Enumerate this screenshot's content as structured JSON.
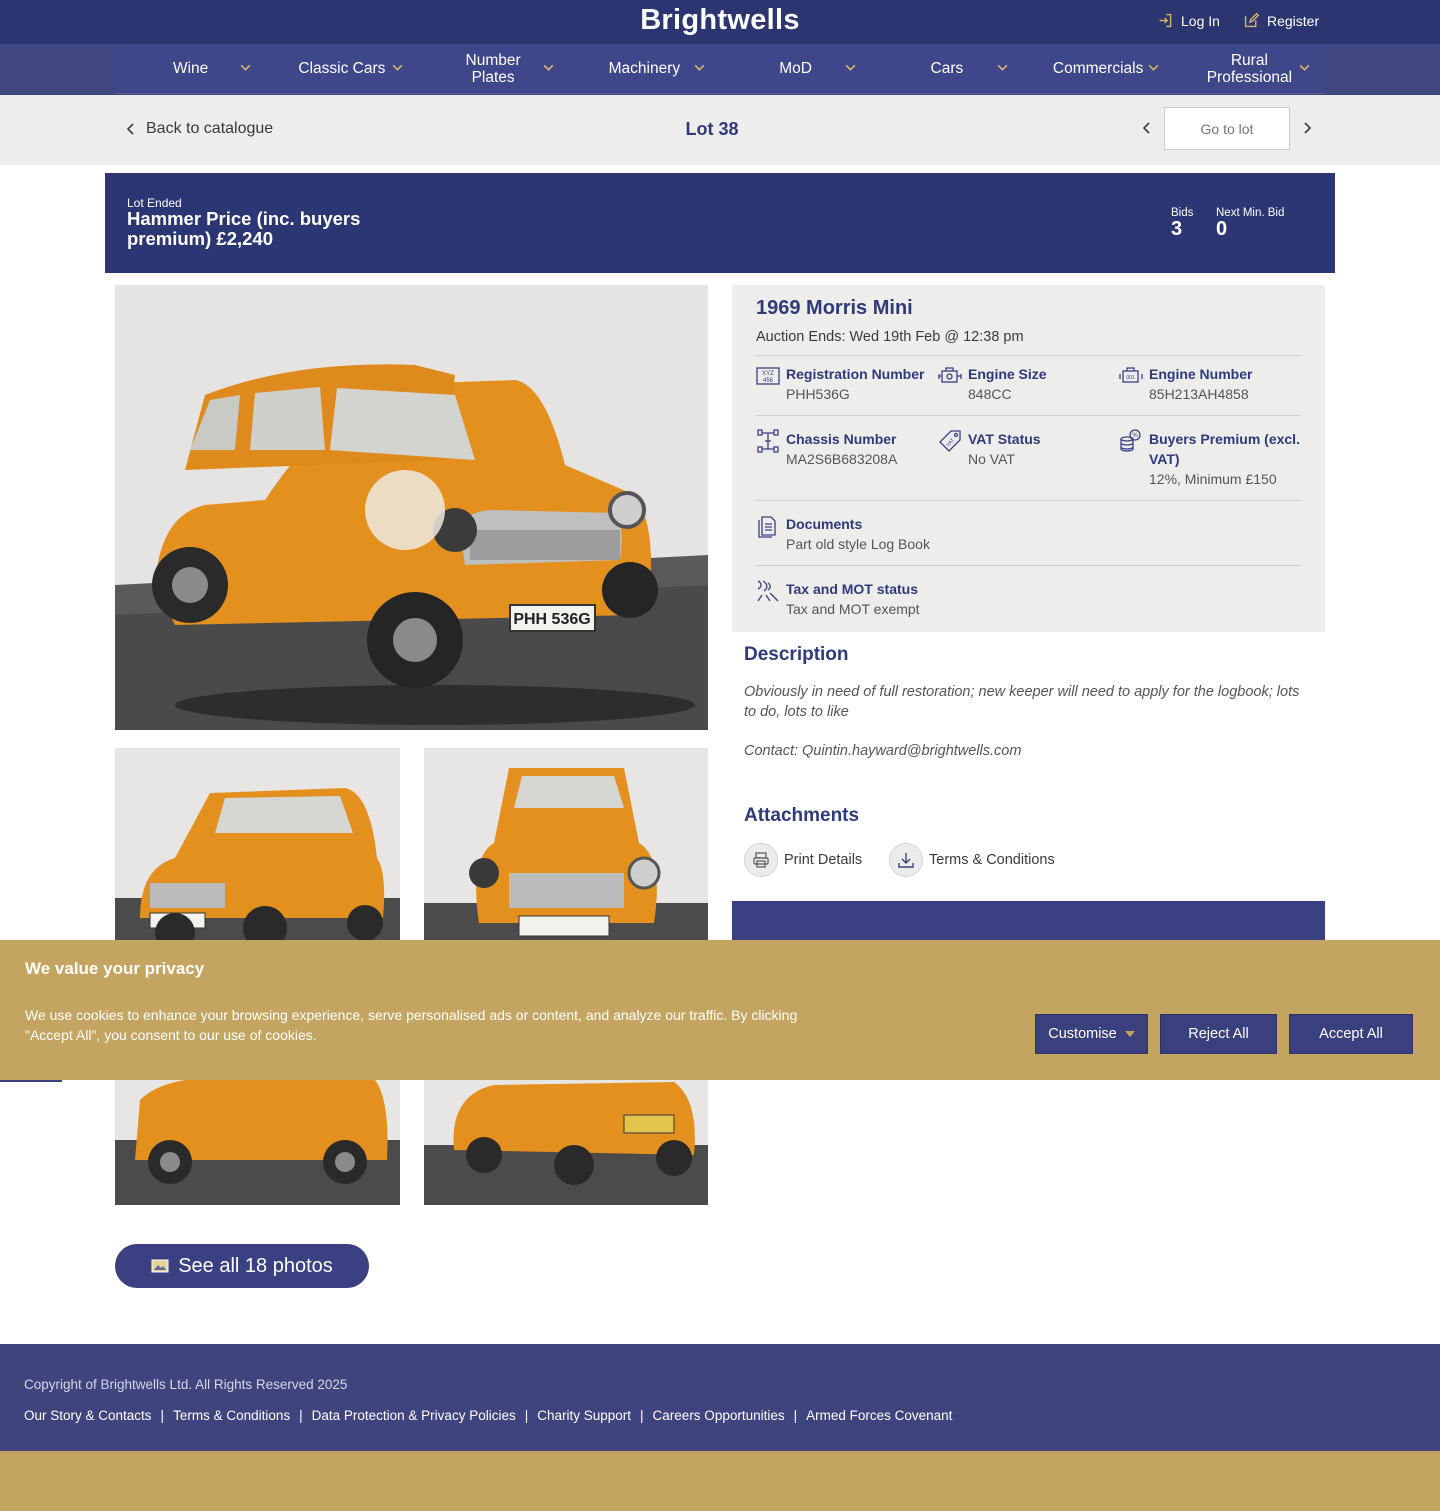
{
  "header": {
    "logo": "Brightwells",
    "login_label": "Log In",
    "register_label": "Register"
  },
  "nav": {
    "items": [
      {
        "label": "Wine"
      },
      {
        "label": "Classic Cars"
      },
      {
        "label": "Number Plates"
      },
      {
        "label": "Machinery"
      },
      {
        "label": "MoD"
      },
      {
        "label": "Cars"
      },
      {
        "label": "Commercials"
      },
      {
        "label": "Rural Professional"
      }
    ]
  },
  "subbar": {
    "back_label": "Back to catalogue",
    "lot_title": "Lot 38",
    "goto_placeholder": "Go to lot"
  },
  "status": {
    "state": "Lot Ended",
    "hammer": "Hammer Price (inc. buyers premium) £2,240",
    "bids_label": "Bids",
    "bids_value": "3",
    "next_min_label": "Next Min. Bid",
    "next_min_value": "0"
  },
  "vehicle": {
    "title": "1969 Morris Mini",
    "auction_ends": "Auction Ends: Wed 19th Feb @ 12:38 pm",
    "specs": {
      "registration": {
        "label": "Registration Number",
        "value": "PHH536G",
        "icon": "registration-plate-icon"
      },
      "engine_size": {
        "label": "Engine Size",
        "value": "848CC",
        "icon": "engine-size-icon"
      },
      "engine_number": {
        "label": "Engine Number",
        "value": "85H213AH4858",
        "icon": "engine-number-icon"
      },
      "chassis": {
        "label": "Chassis Number",
        "value": "MA2S6B683208A",
        "icon": "chassis-icon"
      },
      "vat": {
        "label": "VAT Status",
        "value": "No VAT",
        "icon": "vat-tag-icon"
      },
      "premium": {
        "label": "Buyers Premium (excl. VAT)",
        "value": "12%, Minimum £150",
        "icon": "coins-icon"
      },
      "documents": {
        "label": "Documents",
        "value": "Part old style Log Book",
        "icon": "document-icon"
      },
      "tax_mot": {
        "label": "Tax and MOT status",
        "value": "Tax and MOT exempt",
        "icon": "road-icon"
      }
    }
  },
  "description": {
    "heading": "Description",
    "text": "Obviously in need of full restoration; new keeper will need to apply for the logbook; lots to do, lots to like",
    "contact": "Contact: Quintin.hayward@brightwells.com"
  },
  "attachments": {
    "heading": "Attachments",
    "print_label": "Print Details",
    "terms_label": "Terms & Conditions"
  },
  "photos": {
    "see_all_label": "See all 18 photos",
    "plate_text": "PHH 536G",
    "car_color": "#e4901f"
  },
  "cookie": {
    "heading": "We value your privacy",
    "text": "We use cookies to enhance your browsing experience, serve personalised ads or content, and analyze our traffic. By clicking \"Accept All\", you consent to our use of cookies.",
    "customise_label": "Customise",
    "reject_label": "Reject All",
    "accept_label": "Accept All"
  },
  "footer": {
    "copyright": "Copyright of Brightwells Ltd. All Rights Reserved 2025",
    "links": [
      "Our Story & Contacts",
      "Terms & Conditions",
      "Data Protection & Privacy Policies",
      "Charity Support",
      "Careers Opportunities",
      "Armed Forces Covenant"
    ]
  },
  "colors": {
    "brand_navy": "#2c3570",
    "nav_blue": "#3f4689",
    "gold": "#c3a460",
    "heading_blue": "#2f3a7a"
  }
}
